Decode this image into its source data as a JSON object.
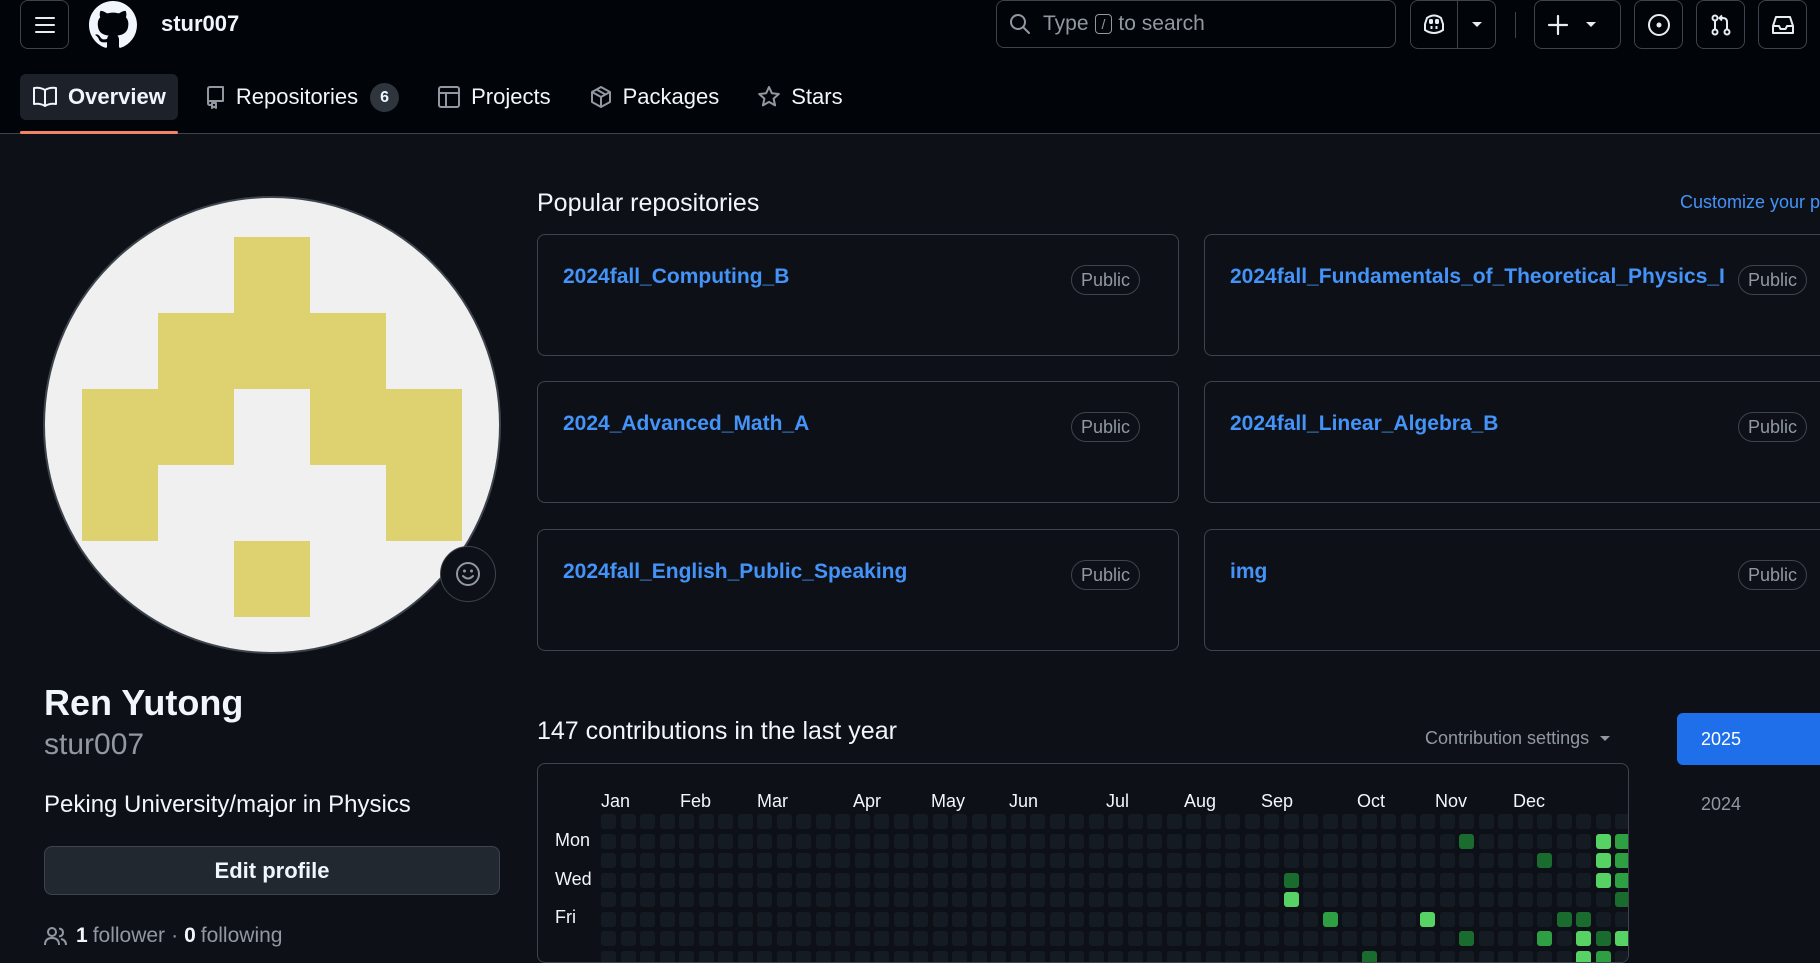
{
  "header": {
    "username": "stur007",
    "search": {
      "prefix": "Type",
      "key": "/",
      "suffix": "to search"
    }
  },
  "tabs": [
    {
      "label": "Overview",
      "icon": "book-icon",
      "active": true
    },
    {
      "label": "Repositories",
      "icon": "repo-icon",
      "count": "6"
    },
    {
      "label": "Projects",
      "icon": "table-icon"
    },
    {
      "label": "Packages",
      "icon": "package-icon"
    },
    {
      "label": "Stars",
      "icon": "star-icon"
    }
  ],
  "profile": {
    "name": "Ren Yutong",
    "login": "stur007",
    "bio": "Peking University/major in Physics",
    "edit_label": "Edit profile",
    "followers_count": "1",
    "followers_label": "follower",
    "separator": "·",
    "following_count": "0",
    "following_label": "following"
  },
  "popular": {
    "title": "Popular repositories",
    "customize": "Customize your p",
    "repos": [
      {
        "name": "2024fall_Computing_B",
        "visibility": "Public"
      },
      {
        "name": "2024fall_Fundamentals_of_Theoretical_Physics_I",
        "visibility": "Public"
      },
      {
        "name": "2024_Advanced_Math_A",
        "visibility": "Public"
      },
      {
        "name": "2024fall_Linear_Algebra_B",
        "visibility": "Public"
      },
      {
        "name": "2024fall_English_Public_Speaking",
        "visibility": "Public"
      },
      {
        "name": "img",
        "visibility": "Public"
      }
    ]
  },
  "contributions": {
    "title": "147 contributions in the last year",
    "settings_label": "Contribution settings",
    "months": [
      "Jan",
      "Feb",
      "Mar",
      "Apr",
      "May",
      "Jun",
      "Jul",
      "Aug",
      "Sep",
      "Oct",
      "Nov",
      "Dec"
    ],
    "day_labels": [
      "Mon",
      "Wed",
      "Fri"
    ],
    "years": [
      "2025",
      "2024"
    ],
    "selected_year": "2025",
    "colors": {
      "empty": "#151b23",
      "l1": "#033a16",
      "l2": "#196c2e",
      "l3": "#2ea043",
      "l4": "#56d364"
    },
    "active_cells": [
      {
        "week": 35,
        "day": 3,
        "level": 2
      },
      {
        "week": 35,
        "day": 4,
        "level": 4
      },
      {
        "week": 37,
        "day": 5,
        "level": 3
      },
      {
        "week": 39,
        "day": 7,
        "level": 2
      },
      {
        "week": 42,
        "day": 5,
        "level": 4
      },
      {
        "week": 44,
        "day": 1,
        "level": 2
      },
      {
        "week": 44,
        "day": 6,
        "level": 2
      },
      {
        "week": 48,
        "day": 2,
        "level": 2
      },
      {
        "week": 48,
        "day": 6,
        "level": 3
      },
      {
        "week": 49,
        "day": 5,
        "level": 2
      },
      {
        "week": 50,
        "day": 5,
        "level": 2
      },
      {
        "week": 50,
        "day": 6,
        "level": 4
      },
      {
        "week": 50,
        "day": 7,
        "level": 4
      },
      {
        "week": 51,
        "day": 1,
        "level": 4
      },
      {
        "week": 51,
        "day": 2,
        "level": 4
      },
      {
        "week": 51,
        "day": 3,
        "level": 4
      },
      {
        "week": 51,
        "day": 6,
        "level": 2
      },
      {
        "week": 51,
        "day": 7,
        "level": 3
      },
      {
        "week": 52,
        "day": 1,
        "level": 3
      },
      {
        "week": 52,
        "day": 2,
        "level": 3
      },
      {
        "week": 52,
        "day": 3,
        "level": 3
      },
      {
        "week": 52,
        "day": 4,
        "level": 2
      },
      {
        "week": 52,
        "day": 6,
        "level": 4
      }
    ]
  }
}
